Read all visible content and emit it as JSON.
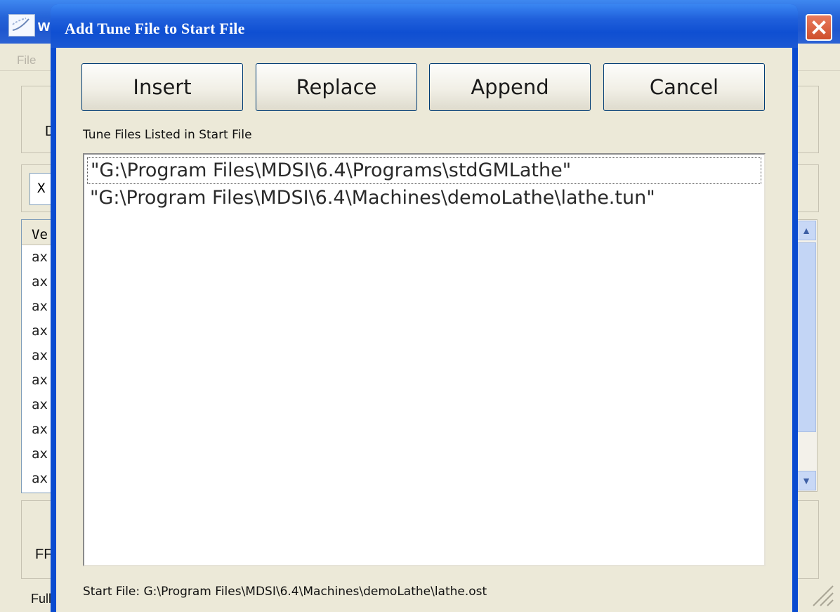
{
  "background_window": {
    "title_stub": "w",
    "menu": {
      "file_label": "File"
    },
    "x_field_value": "X",
    "list_header_stub": "Ve",
    "list_rows": [
      "ax",
      "ax",
      "ax",
      "ax",
      "ax",
      "ax",
      "ax",
      "ax",
      "ax",
      "ax"
    ],
    "group_label_stub": "D",
    "ff_stub": "FF",
    "full_stub": "Full"
  },
  "dialog": {
    "title": "Add Tune File to Start File",
    "buttons": {
      "insert": "Insert",
      "replace": "Replace",
      "append": "Append",
      "cancel": "Cancel"
    },
    "list_label": "Tune Files Listed in Start File",
    "tune_files": [
      "\"G:\\Program Files\\MDSI\\6.4\\Programs\\stdGMLathe\"",
      "\"G:\\Program Files\\MDSI\\6.4\\Machines\\demoLathe\\lathe.tun\""
    ],
    "start_file_text": "Start File: G:\\Program Files\\MDSI\\6.4\\Machines\\demoLathe\\lathe.ost"
  },
  "colors": {
    "titlebar_blue": "#0f4fd2",
    "dialog_face": "#ece9d8",
    "close_red": "#cf4f2c"
  }
}
